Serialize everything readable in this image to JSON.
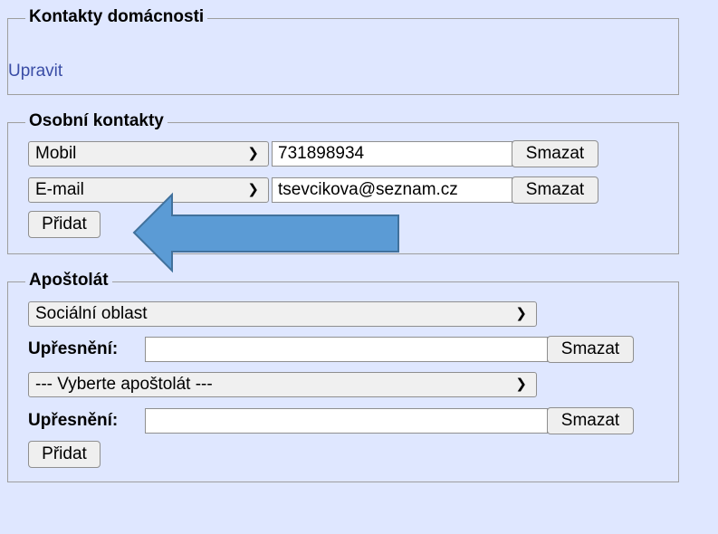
{
  "household": {
    "legend": "Kontakty domácnosti",
    "edit_link": "Upravit"
  },
  "personal": {
    "legend": "Osobní kontakty",
    "rows": [
      {
        "type": "Mobil",
        "value": "731898934",
        "delete_label": "Smazat"
      },
      {
        "type": "E-mail",
        "value": "tsevcikova@seznam.cz",
        "delete_label": "Smazat"
      }
    ],
    "add_label": "Přidat"
  },
  "apostolate": {
    "legend": "Apoštolát",
    "entries": [
      {
        "select": "Sociální oblast",
        "detail_label": "Upřesnění:",
        "detail_value": "",
        "delete_label": "Smazat"
      },
      {
        "select": "--- Vyberte apoštolát ---",
        "detail_label": "Upřesnění:",
        "detail_value": "",
        "delete_label": "Smazat"
      }
    ],
    "add_label": "Přidat"
  },
  "icons": {
    "select_chevron": "chevron-down-icon",
    "annotation": "left-arrow-icon"
  },
  "colors": {
    "background": "#dfe7ff",
    "link": "#3a4da6",
    "arrow_fill": "#5b9bd5",
    "arrow_stroke": "#41719c"
  }
}
